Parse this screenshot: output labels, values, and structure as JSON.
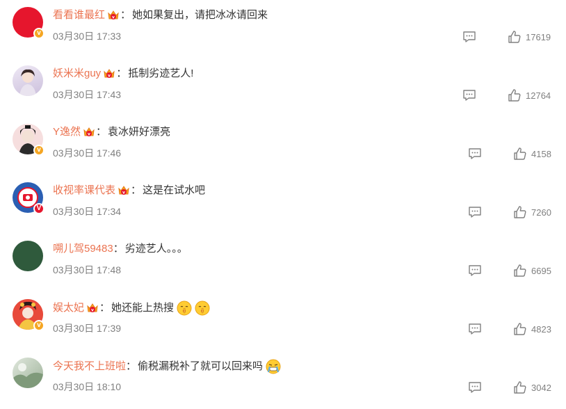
{
  "comments": [
    {
      "username": "看看谁最红",
      "colon": "：",
      "text": "她如果复出，请把冰冰请回来",
      "time": "03月30日 17:33",
      "likes": "17619",
      "avatar_color": "#e6162d",
      "badge": "gold",
      "emojis": []
    },
    {
      "username": "妖米米guy",
      "colon": "：",
      "text": "抵制劣迹艺人!",
      "time": "03月30日 17:43",
      "likes": "12764",
      "avatar_color": "#d9cfe8",
      "badge": "none",
      "emojis": []
    },
    {
      "username": "Y逸然",
      "colon": "：",
      "text": "袁冰妍好漂亮",
      "time": "03月30日 17:46",
      "likes": "4158",
      "avatar_color": "#f1d6d6",
      "badge": "gold",
      "emojis": []
    },
    {
      "username": "收视率课代表",
      "colon": "：",
      "text": "这是在试水吧",
      "time": "03月30日 17:34",
      "likes": "7260",
      "avatar_color": "#2b5fb3",
      "badge": "red",
      "emojis": []
    },
    {
      "username": "嗍儿驾59483",
      "colon": "：",
      "text": "劣迹艺人。。。",
      "time": "03月30日 17:48",
      "likes": "6695",
      "avatar_color": "#2f5a3c",
      "badge": "none",
      "emojis": []
    },
    {
      "username": "娱太妃",
      "colon": "：",
      "text": "她还能上热搜",
      "time": "03月30日 17:39",
      "likes": "4823",
      "avatar_color": "#d93a2b",
      "badge": "gold",
      "emojis": [
        "shush-emoji",
        "shush-emoji"
      ]
    },
    {
      "username": "今天我不上班啦",
      "colon": "：",
      "text": "偷税漏税补了就可以回来吗",
      "time": "03月30日 18:10",
      "likes": "3042",
      "avatar_color": "#b9c7b5",
      "badge": "none",
      "emojis": [
        "cry-emoji"
      ]
    }
  ],
  "icons": {
    "reply": "comment-icon",
    "like": "thumbs-up-icon",
    "vip": "vip-crown-icon",
    "verified": "verified-v-icon"
  },
  "colors": {
    "username": "#eb7350",
    "meta": "#808080",
    "badge_gold": "#f5a623",
    "badge_red": "#e6162d"
  }
}
